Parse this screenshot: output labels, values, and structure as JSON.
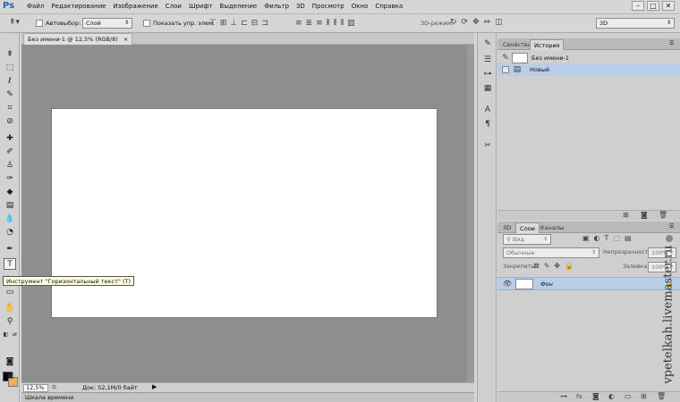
{
  "app": {
    "logo": "Ps",
    "menu": [
      "Файл",
      "Редактирование",
      "Изображение",
      "Слои",
      "Шрифт",
      "Выделение",
      "Фильтр",
      "3D",
      "Просмотр",
      "Окно",
      "Справка"
    ],
    "window_controls": [
      "–",
      "□",
      "✕"
    ]
  },
  "options_bar": {
    "autoselect_label": "Автовыбор:",
    "autoselect_value": "Слой",
    "show_controls_label": "Показать упр. элем.",
    "mode_3d_label": "3D-режим:",
    "workspace_value": "3D"
  },
  "document": {
    "tab_title": "Без имени-1 @ 12,5% (RGB/8)",
    "tab_close": "×",
    "zoom": "12,5%",
    "doc_info": "Док: 52,1M/0 байт",
    "timeline_label": "Шкала времени"
  },
  "tooltip": {
    "text": "Инструмент \"Горизонтальный текст\" (T)"
  },
  "history_panel": {
    "tabs": [
      "Свойства",
      "История"
    ],
    "active_tab": "История",
    "snapshot_label": "Без имени-1",
    "states": [
      "Новый"
    ]
  },
  "layers_panel": {
    "tabs": [
      "3D",
      "Слои",
      "Каналы"
    ],
    "active_tab": "Слои",
    "filter_label": "Вид",
    "blend_mode": "Обычные",
    "opacity_label": "Непрозрачность:",
    "opacity_value": "100%",
    "lock_label": "Закрепить:",
    "fill_label": "Заливка:",
    "fill_value": "100%",
    "layers": [
      {
        "name": "Фон"
      }
    ]
  },
  "watermark": "vpetelkah.livemaster.ru",
  "colors": {
    "background_swatch": "#e6b35c",
    "foreground_swatch": "#000000",
    "selection_highlight": "#b9cde6",
    "logo_blue": "#2a5db0"
  }
}
